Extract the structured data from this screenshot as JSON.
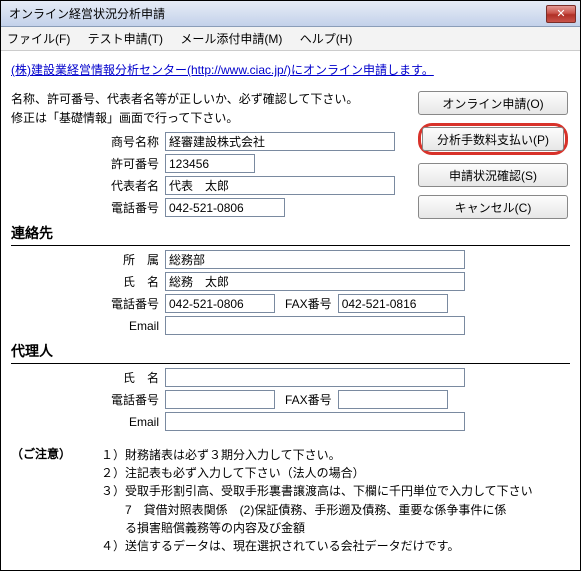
{
  "window": {
    "title": "オンライン経営状況分析申請"
  },
  "menu": {
    "file": "ファイル(F)",
    "test": "テスト申請(T)",
    "mail": "メール添付申請(M)",
    "help": "ヘルプ(H)"
  },
  "link": "(株)建設業経営情報分析センター(http://www.ciac.jp/)にオンライン申請します。",
  "notes": {
    "n1": "名称、許可番号、代表者名等が正しいか、必ず確認して下さい。",
    "n2": "修正は「基礎情報」画面で行って下さい。"
  },
  "buttons": {
    "online": "オンライン申請(O)",
    "pay": "分析手数料支払い(P)",
    "status": "申請状況確認(S)",
    "cancel": "キャンセル(C)"
  },
  "labels": {
    "shougou": "商号名称",
    "kyoka": "許可番号",
    "daihyou": "代表者名",
    "tel": "電話番号",
    "renraku": "連絡先",
    "shozoku": "所　属",
    "shimei": "氏　名",
    "fax": "FAX番号",
    "email": "Email",
    "dairi": "代理人",
    "caution": "（ご注意）"
  },
  "fields": {
    "shougou": "経審建設株式会社",
    "kyoka": "123456",
    "daihyou": "代表　太郎",
    "tel": "042-521-0806",
    "renraku_shozoku": "総務部",
    "renraku_shimei": "総務　太郎",
    "renraku_tel": "042-521-0806",
    "renraku_fax": "042-521-0816",
    "renraku_email": "",
    "dairi_shimei": "",
    "dairi_tel": "",
    "dairi_fax": "",
    "dairi_email": ""
  },
  "caution": {
    "c1": "１）財務諸表は必ず３期分入力して下さい。",
    "c2": "２）注記表も必ず入力して下さい（法人の場合）",
    "c3a": "３）受取手形割引高、受取手形裏書譲渡高は、下欄に千円単位で入力して下さい",
    "c3b": "　　7　貸借対照表関係　(2)保証債務、手形遡及債務、重要な係争事件に係",
    "c3c": "　　る損害賠償義務等の内容及び金額",
    "c4": "４）送信するデータは、現在選択されている会社データだけです。"
  }
}
